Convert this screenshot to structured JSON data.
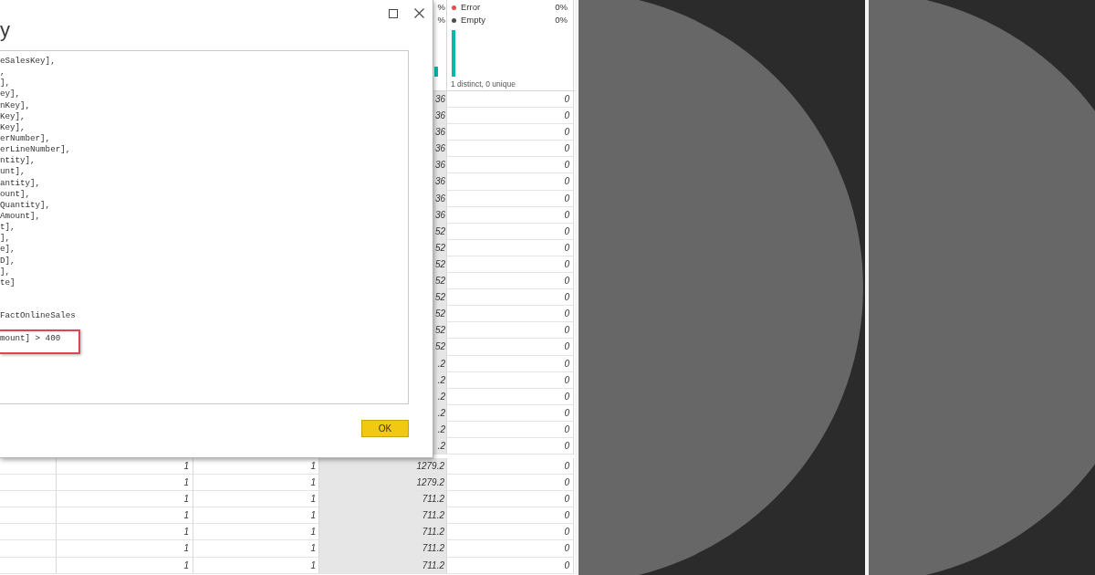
{
  "dialog": {
    "title": "y",
    "query_lines": [
      {
        "kind": "code",
        "text": "eSalesKey],",
        "highlighted": false
      },
      {
        "kind": "code",
        "text": ",",
        "highlighted": false
      },
      {
        "kind": "code",
        "text": "],",
        "highlighted": false
      },
      {
        "kind": "code",
        "text": "ey],",
        "highlighted": false
      },
      {
        "kind": "code",
        "text": "nKey],",
        "highlighted": false
      },
      {
        "kind": "code",
        "text": "Key],",
        "highlighted": false
      },
      {
        "kind": "code",
        "text": "Key],",
        "highlighted": false
      },
      {
        "kind": "code",
        "text": "erNumber],",
        "highlighted": false
      },
      {
        "kind": "code",
        "text": "erLineNumber],",
        "highlighted": false
      },
      {
        "kind": "code",
        "text": "ntity],",
        "highlighted": false
      },
      {
        "kind": "code",
        "text": "unt],",
        "highlighted": false
      },
      {
        "kind": "code",
        "text": "antity],",
        "highlighted": false
      },
      {
        "kind": "code",
        "text": "ount],",
        "highlighted": false
      },
      {
        "kind": "code",
        "text": "Quantity],",
        "highlighted": false
      },
      {
        "kind": "code",
        "text": "Amount],",
        "highlighted": false
      },
      {
        "kind": "code",
        "text": "t],",
        "highlighted": false
      },
      {
        "kind": "code",
        "text": "],",
        "highlighted": false
      },
      {
        "kind": "code",
        "text": "e],",
        "highlighted": false
      },
      {
        "kind": "code",
        "text": "D],",
        "highlighted": false
      },
      {
        "kind": "code",
        "text": "],",
        "highlighted": false
      },
      {
        "kind": "code",
        "text": "te]",
        "highlighted": false
      },
      {
        "kind": "blank"
      },
      {
        "kind": "blank"
      },
      {
        "kind": "code",
        "text": "FactOnlineSales",
        "highlighted": false
      },
      {
        "kind": "blank"
      },
      {
        "kind": "code",
        "text": "mount] > 400",
        "highlighted": true
      }
    ],
    "buttons": [
      "OK"
    ]
  },
  "grid": {
    "profile": {
      "column_4": {
        "legend_values": [
          "%",
          "%"
        ]
      },
      "column_5": {
        "legend": [
          {
            "label": "Error",
            "value": "0%",
            "color": "#e8474b"
          },
          {
            "label": "Empty",
            "value": "0%",
            "color": "#4d4d4d"
          }
        ],
        "summary": "1 distinct, 0 unique"
      }
    },
    "rows": [
      {
        "column_4": "36",
        "column_5": "0"
      },
      {
        "column_4": "36",
        "column_5": "0"
      },
      {
        "column_4": "36",
        "column_5": "0"
      },
      {
        "column_4": "36",
        "column_5": "0"
      },
      {
        "column_4": "36",
        "column_5": "0"
      },
      {
        "column_4": "36",
        "column_5": "0"
      },
      {
        "column_4": "36",
        "column_5": "0"
      },
      {
        "column_4": "36",
        "column_5": "0"
      },
      {
        "column_4": "52",
        "column_5": "0"
      },
      {
        "column_4": "52",
        "column_5": "0"
      },
      {
        "column_4": "52",
        "column_5": "0"
      },
      {
        "column_4": "52",
        "column_5": "0"
      },
      {
        "column_4": "52",
        "column_5": "0"
      },
      {
        "column_4": "52",
        "column_5": "0"
      },
      {
        "column_4": "52",
        "column_5": "0"
      },
      {
        "column_4": "52",
        "column_5": "0"
      },
      {
        "column_4": ".2",
        "column_5": "0"
      },
      {
        "column_4": ".2",
        "column_5": "0"
      },
      {
        "column_4": ".2",
        "column_5": "0"
      },
      {
        "column_4": ".2",
        "column_5": "0"
      },
      {
        "column_4": ".2",
        "column_5": "0"
      },
      {
        "column_4": ".2",
        "column_5": "0"
      },
      {
        "column_2": "1",
        "column_3": "1",
        "column_4": "1279.2",
        "column_5": "0"
      },
      {
        "column_2": "1",
        "column_3": "1",
        "column_4": "1279.2",
        "column_5": "0"
      },
      {
        "column_2": "1",
        "column_3": "1",
        "column_4": "711.2",
        "column_5": "0"
      },
      {
        "column_2": "1",
        "column_3": "1",
        "column_4": "711.2",
        "column_5": "0"
      },
      {
        "column_2": "1",
        "column_3": "1",
        "column_4": "711.2",
        "column_5": "0"
      },
      {
        "column_2": "1",
        "column_3": "1",
        "column_4": "711.2",
        "column_5": "0"
      },
      {
        "column_2": "1",
        "column_3": "1",
        "column_4": "711.2",
        "column_5": "0"
      }
    ]
  }
}
